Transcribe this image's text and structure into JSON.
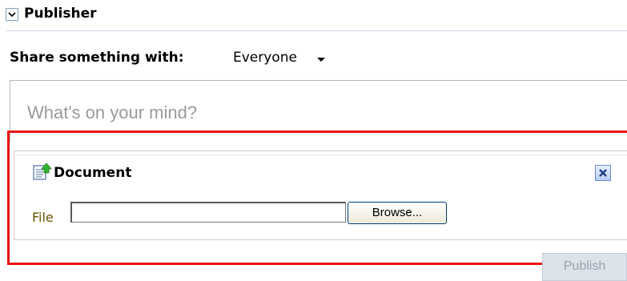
{
  "header": {
    "title": "Publisher",
    "toggle_icon": "chevron-down-icon"
  },
  "share": {
    "label": "Share something with:",
    "audience": "Everyone"
  },
  "status": {
    "placeholder": "What's on your mind?"
  },
  "document_panel": {
    "title": "Document",
    "icon": "document-upload-icon",
    "close_icon": "close-icon",
    "file_label": "File",
    "file_value": "",
    "browse_label": "Browse..."
  },
  "actions": {
    "publish_label": "Publish"
  },
  "colors": {
    "highlight": "#e81416",
    "file_label": "#6b5400",
    "publish_disabled_bg": "#dde3ea"
  }
}
